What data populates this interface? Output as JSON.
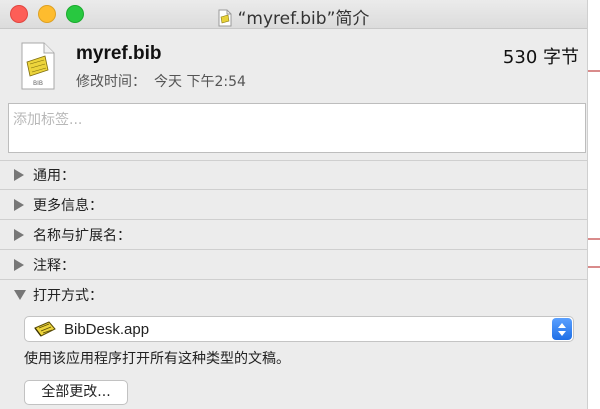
{
  "window": {
    "title": "“myref.bib”简介",
    "controls": [
      "close",
      "minimize",
      "zoom"
    ]
  },
  "file": {
    "name": "myref.bib",
    "size": "530 字节",
    "modified_label": "修改时间：",
    "modified_value": "今天 下午2:54",
    "icon": "bibtex-document-icon"
  },
  "tags": {
    "placeholder": "添加标签..."
  },
  "sections": [
    {
      "label": "通用：",
      "expanded": false
    },
    {
      "label": "更多信息：",
      "expanded": false
    },
    {
      "label": "名称与扩展名：",
      "expanded": false
    },
    {
      "label": "注释：",
      "expanded": false
    },
    {
      "label": "打开方式：",
      "expanded": true
    }
  ],
  "open_with": {
    "selected_app": "BibDesk.app",
    "description": "使用该应用程序打开所有这种类型的文稿。",
    "change_all_label": "全部更改..."
  },
  "colors": {
    "window_bg": "#ececec",
    "accent": "#1f6fe6",
    "close": "#fd5e57",
    "minimize": "#febc2e",
    "zoom": "#28c840"
  }
}
